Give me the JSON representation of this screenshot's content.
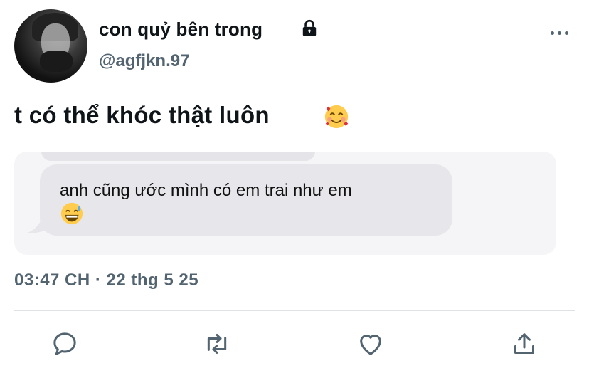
{
  "user": {
    "display_name": "con quỷ bên trong",
    "handle": "@agfjkn.97",
    "protected_icon": "lock-icon"
  },
  "tweet": {
    "text": "t có thể khóc thật luôn",
    "emoji": "smiling-face-with-hearts-icon",
    "timestamp": "03:47 CH · 22 thg 5 25"
  },
  "attached_screenshot": {
    "message_text": "anh cũng ước mình có em trai như em",
    "message_emoji": "grinning-sweat-face-icon"
  },
  "actions": {
    "reply": "reply-icon",
    "retweet": "retweet-icon",
    "like": "like-icon",
    "share": "share-icon"
  },
  "colors": {
    "secondary_text": "#536471",
    "bubble": "#e6e6eb"
  }
}
